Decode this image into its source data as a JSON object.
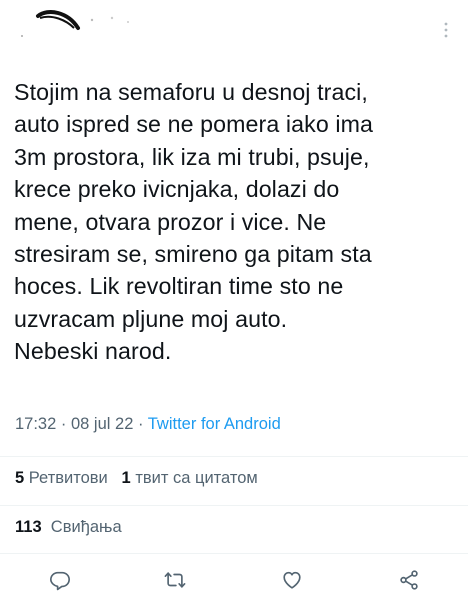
{
  "tweet": {
    "text": "Stojim na semaforu u desnoj traci,\nauto ispred se ne pomera iako ima\n3m prostora, lik iza mi trubi, psuje,\nkrece preko ivicnjaka, dolazi do\nmene, otvara prozor i vice. Ne\nstresiram se, smireno ga pitam sta\nhoces. Lik revoltiran time sto ne\nuzvracam pljune moj auto.\nNebeski narod.",
    "time": "17:32",
    "separator": "·",
    "date": "08 jul 22",
    "source": "Twitter for Android"
  },
  "stats": {
    "retweets_count": "5",
    "retweets_label": "Ретвитови",
    "quotes_count": "1",
    "quotes_label": "твит са цитатом",
    "likes_count": "113",
    "likes_label": "Свиђања"
  },
  "actions": {
    "reply_icon": "reply-icon",
    "retweet_icon": "retweet-icon",
    "like_icon": "heart-icon",
    "share_icon": "share-icon"
  },
  "colors": {
    "text": "#0f1419",
    "secondary": "#536471",
    "link": "#1d9bf0",
    "divider": "#eff3f4"
  }
}
